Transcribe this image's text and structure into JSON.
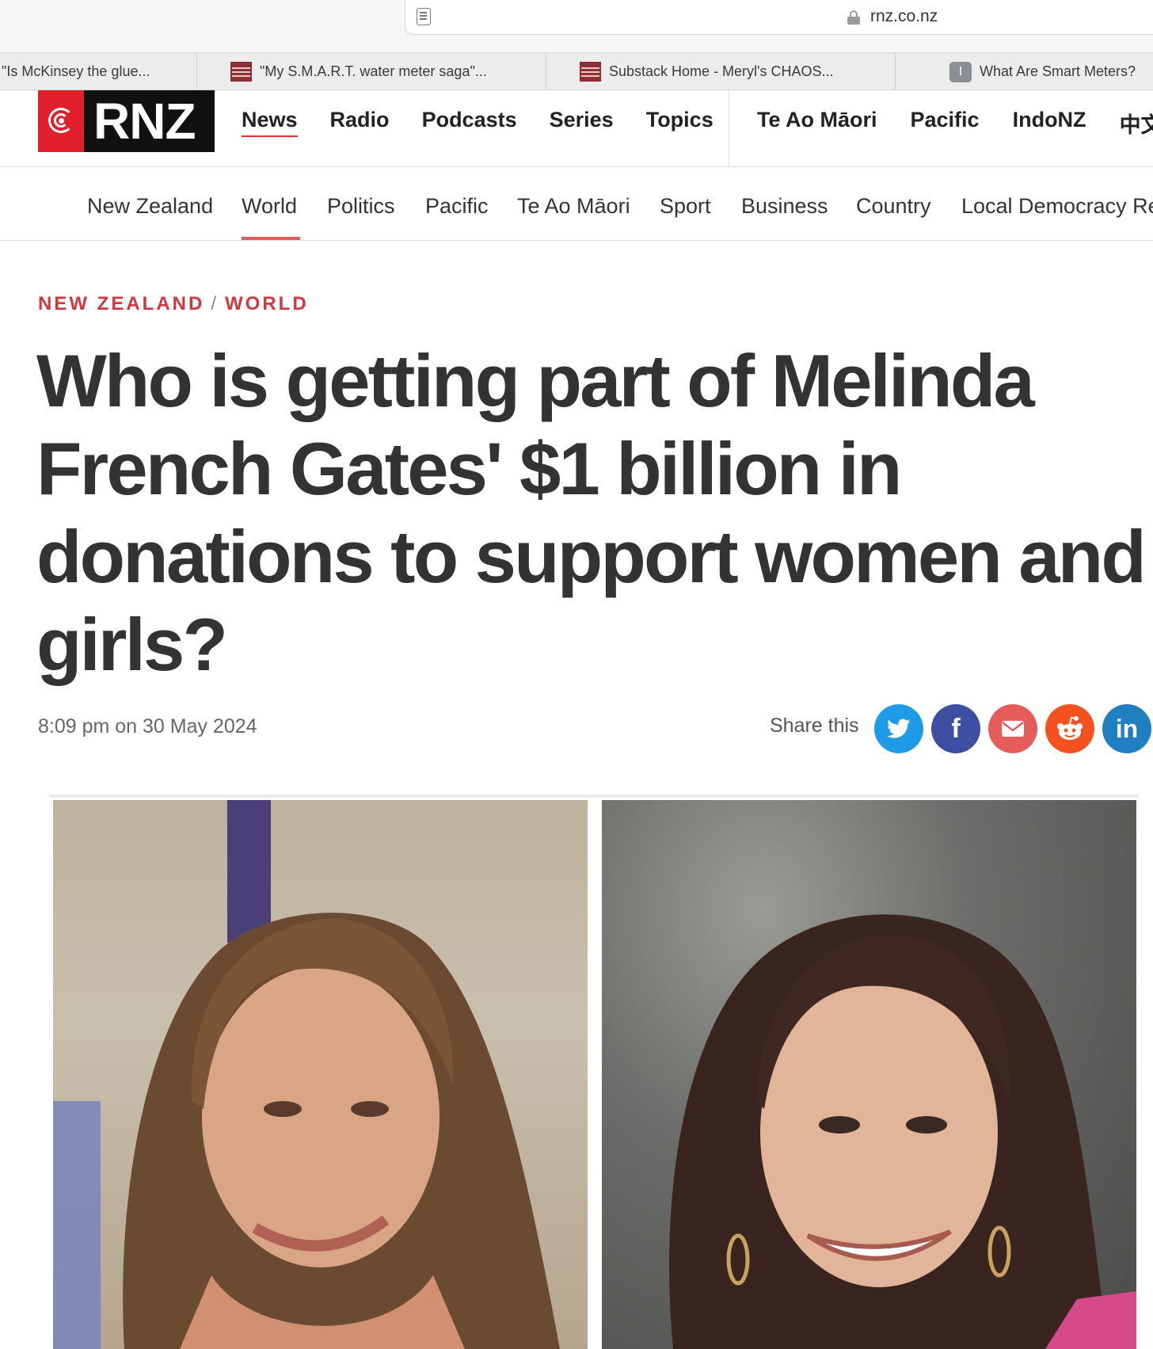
{
  "browser": {
    "url": "rnz.co.nz",
    "tabs": [
      {
        "title": "\"Is McKinsey the glue..."
      },
      {
        "title": "\"My S.M.A.R.T. water meter saga\"..."
      },
      {
        "title": "Substack Home - Meryl's CHAOS..."
      },
      {
        "title": "What Are Smart Meters?",
        "icon_letter": "I"
      }
    ]
  },
  "site": {
    "logo_text": "RNZ",
    "brand_color": "#e1202b",
    "primary_nav": [
      "News",
      "Radio",
      "Podcasts",
      "Series",
      "Topics"
    ],
    "secondary_nav": [
      "Te Ao Māori",
      "Pacific",
      "IndoNZ",
      "中文"
    ],
    "section_nav": [
      "New Zealand",
      "World",
      "Politics",
      "Pacific",
      "Te Ao Māori",
      "Sport",
      "Business",
      "Country",
      "Local Democracy Re"
    ],
    "active_section": "World"
  },
  "article": {
    "kicker": [
      "NEW ZEALAND",
      "WORLD"
    ],
    "kicker_separator": "/",
    "headline": "Who is getting part of Melinda French Gates' $1 billion in donations to support women and girls?",
    "dateline": "8:09 pm on 30 May 2024",
    "share_label": "Share this",
    "share_buttons": [
      {
        "name": "twitter",
        "color": "#1d9be6",
        "glyph": "🐦"
      },
      {
        "name": "facebook",
        "color": "#3d4ea3",
        "glyph": "f"
      },
      {
        "name": "email",
        "color": "#e85b5b",
        "glyph": "✉"
      },
      {
        "name": "reddit",
        "color": "#f4511e",
        "glyph": "👽"
      },
      {
        "name": "linkedin",
        "color": "#1f7fc0",
        "glyph": "in"
      }
    ]
  }
}
